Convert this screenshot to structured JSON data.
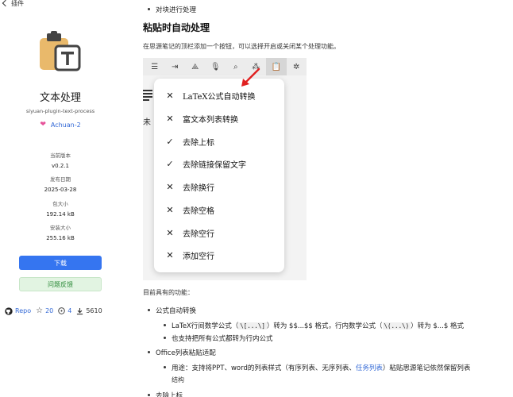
{
  "back": {
    "label": "插件"
  },
  "plugin": {
    "title": "文本处理",
    "package": "siyuan-plugin-text-process",
    "author": "Achuan-2"
  },
  "meta": [
    {
      "key": "当前版本",
      "value": "v0.2.1"
    },
    {
      "key": "发布日期",
      "value": "2025-03-28"
    },
    {
      "key": "包大小",
      "value": "192.14 kB"
    },
    {
      "key": "安装大小",
      "value": "255.16 kB"
    }
  ],
  "buttons": {
    "download": "下载",
    "feedback": "问题反馈"
  },
  "stats": {
    "repo": "Repo",
    "stars": "20",
    "issues": "4",
    "downloads": "5610"
  },
  "content": {
    "top_item": "对块进行处理",
    "heading": "粘贴时自动处理",
    "intro": "在思源笔记的顶栏添加一个按钮，可以选择开启或关闭某个处理功能。",
    "menu": [
      {
        "icon": "x",
        "label": "LaTeX公式自动转换"
      },
      {
        "icon": "x",
        "label": "富文本列表转换"
      },
      {
        "icon": "check",
        "label": "去除上标"
      },
      {
        "icon": "check",
        "label": "去除链接保留文字"
      },
      {
        "icon": "x",
        "label": "去除换行"
      },
      {
        "icon": "x",
        "label": "去除空格"
      },
      {
        "icon": "x",
        "label": "去除空行"
      },
      {
        "icon": "x",
        "label": "添加空行"
      }
    ],
    "fig_char": "未",
    "features_intro": "目前具有的功能：",
    "f1": "公式自动转换",
    "f1a_pre": "LaTeX行间数学公式（",
    "f1a_code1": "\\[...\\]",
    "f1a_mid1": "）转为 $$...$$ 格式，行内数学公式（",
    "f1a_code2": "\\(...\\)",
    "f1a_mid2": "）转为 $...$ 格式",
    "f1b": "也支持把所有公式都转为行内公式",
    "f2": "Office列表粘贴适配",
    "f2a_pre": "用途：支持将PPT、word的列表样式（有序列表、无序列表、",
    "f2a_link": "任务列表",
    "f2a_post": "）粘贴思源笔记依然保留列表",
    "f2a_wrap": "结构",
    "f3": "去除上标"
  },
  "colors": {
    "primary": "#3575f0",
    "feedback_bg": "#e2f4e2",
    "link": "#3369d6",
    "heart": "#e6539a",
    "arrow": "#e02020"
  }
}
